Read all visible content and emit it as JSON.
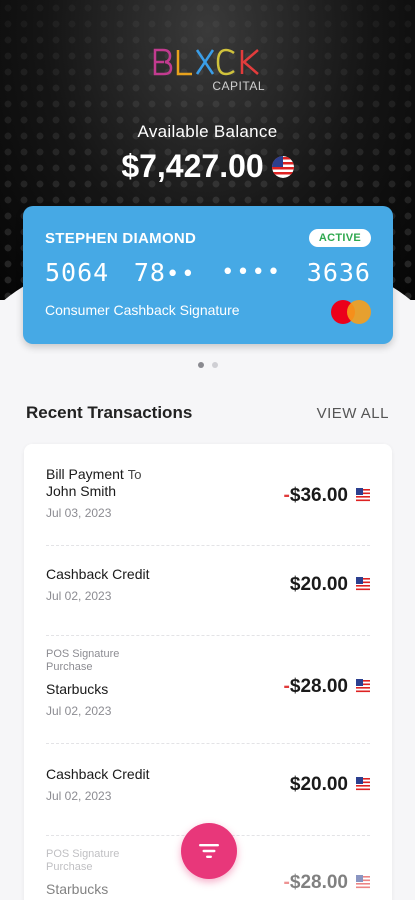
{
  "brand": {
    "logo_text": "BLXCK",
    "logo_sub": "CAPITAL"
  },
  "balance": {
    "label": "Available Balance",
    "amount": "$7,427.00",
    "currency_icon": "us-flag-icon"
  },
  "card": {
    "holder": "STEPHEN DIAMOND",
    "status": "ACTIVE",
    "number_first": "5064",
    "number_second": "78",
    "mask_a": "••",
    "mask_b": "••••",
    "number_last": "3636",
    "type": "Consumer Cashback Signature",
    "network_icon": "mastercard-icon",
    "color": "#46a9e5",
    "status_color": "#2fa84f"
  },
  "carousel": {
    "count": 2,
    "active": 0
  },
  "recent": {
    "title": "Recent Transactions",
    "view_all": "VIEW ALL"
  },
  "transactions": [
    {
      "type": "",
      "name": "Bill Payment",
      "to_label": "To",
      "name2": "John Smith",
      "date": "Jul 03, 2023",
      "sign": "-",
      "amount": "$36.00",
      "debit": true
    },
    {
      "type": "",
      "name": "Cashback Credit",
      "date": "Jul 02, 2023",
      "sign": "",
      "amount": "$20.00",
      "debit": false
    },
    {
      "type_line1": "POS Signature",
      "type_line2": "Purchase",
      "name": "Starbucks",
      "date": "Jul 02, 2023",
      "sign": "-",
      "amount": "$28.00",
      "debit": true
    },
    {
      "type": "",
      "name": "Cashback Credit",
      "date": "Jul 02, 2023",
      "sign": "",
      "amount": "$20.00",
      "debit": false
    },
    {
      "type_line1": "POS Signature",
      "type_line2": "Purchase",
      "name": "Starbucks",
      "date": "",
      "sign": "-",
      "amount": "$28.00",
      "debit": true
    }
  ],
  "fab": {
    "icon": "filter-icon"
  },
  "colors": {
    "accent": "#e8377a",
    "debit": "#e03b3b"
  }
}
